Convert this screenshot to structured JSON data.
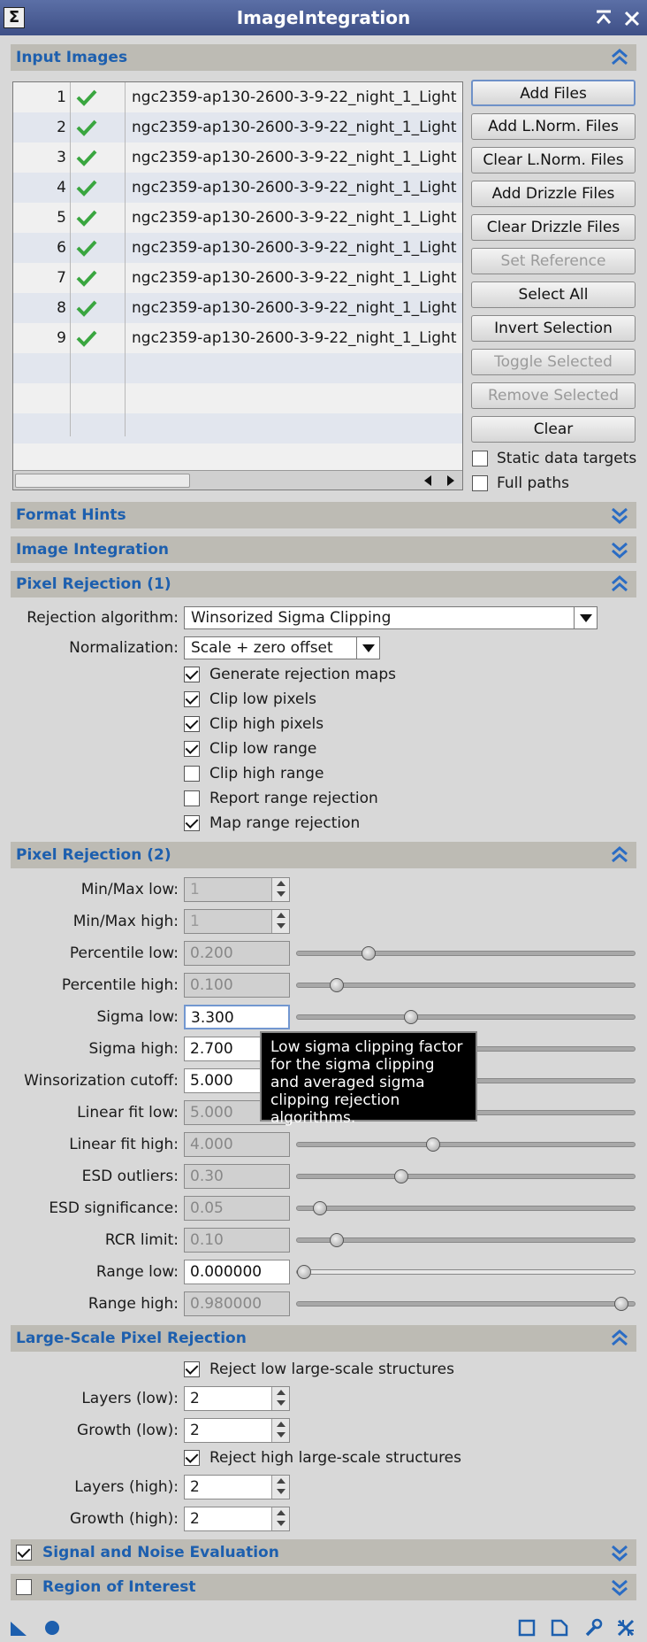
{
  "window": {
    "title": "ImageIntegration",
    "app_icon": "Σ",
    "collapse_icon": "collapse-icon",
    "close_icon": "close-icon"
  },
  "colors": {
    "section_title": "#1d5fae",
    "title_bar": "#4a5c94",
    "check_green": "#3aa640",
    "arrow_blue": "#2a6cc4"
  },
  "input_images": {
    "title": "Input Images",
    "files": [
      {
        "index": "1",
        "name": "ngc2359-ap130-2600-3-9-22_night_1_Light"
      },
      {
        "index": "2",
        "name": "ngc2359-ap130-2600-3-9-22_night_1_Light"
      },
      {
        "index": "3",
        "name": "ngc2359-ap130-2600-3-9-22_night_1_Light"
      },
      {
        "index": "4",
        "name": "ngc2359-ap130-2600-3-9-22_night_1_Light"
      },
      {
        "index": "5",
        "name": "ngc2359-ap130-2600-3-9-22_night_1_Light"
      },
      {
        "index": "6",
        "name": "ngc2359-ap130-2600-3-9-22_night_1_Light"
      },
      {
        "index": "7",
        "name": "ngc2359-ap130-2600-3-9-22_night_1_Light"
      },
      {
        "index": "8",
        "name": "ngc2359-ap130-2600-3-9-22_night_1_Light"
      },
      {
        "index": "9",
        "name": "ngc2359-ap130-2600-3-9-22_night_1_Light"
      }
    ],
    "buttons": {
      "add_files": "Add Files",
      "add_lnorm": "Add L.Norm. Files",
      "clear_lnorm": "Clear L.Norm. Files",
      "add_drizzle": "Add Drizzle Files",
      "clear_drizzle": "Clear Drizzle Files",
      "set_reference": "Set Reference",
      "select_all": "Select All",
      "invert_selection": "Invert Selection",
      "toggle_selected": "Toggle Selected",
      "remove_selected": "Remove Selected",
      "clear": "Clear"
    },
    "static_data_targets": "Static data targets",
    "full_paths": "Full paths"
  },
  "sections": {
    "format_hints": "Format Hints",
    "image_integration": "Image Integration",
    "pixel_rejection_1": "Pixel Rejection (1)",
    "pixel_rejection_2": "Pixel Rejection (2)",
    "large_scale": "Large-Scale Pixel Rejection",
    "signal_noise": "Signal and Noise Evaluation",
    "roi": "Region of Interest"
  },
  "pixel_rejection_1": {
    "rejection_algorithm_label": "Rejection algorithm:",
    "rejection_algorithm_value": "Winsorized Sigma Clipping",
    "normalization_label": "Normalization:",
    "normalization_value": "Scale + zero offset",
    "options": {
      "generate_maps": "Generate rejection maps",
      "clip_low_pixels": "Clip low pixels",
      "clip_high_pixels": "Clip high pixels",
      "clip_low_range": "Clip low range",
      "clip_high_range": "Clip high range",
      "report_range": "Report range rejection",
      "map_range": "Map range rejection"
    }
  },
  "pixel_rejection_2": {
    "minmax_low_label": "Min/Max low:",
    "minmax_low": "1",
    "minmax_high_label": "Min/Max high:",
    "minmax_high": "1",
    "percentile_low_label": "Percentile low:",
    "percentile_low": "0.200",
    "percentile_low_pos": 0.2,
    "percentile_high_label": "Percentile high:",
    "percentile_high": "0.100",
    "percentile_high_pos": 0.1,
    "sigma_low_label": "Sigma low:",
    "sigma_low": "3.300",
    "sigma_low_pos": 0.33,
    "sigma_high_label": "Sigma high:",
    "sigma_high": "2.700",
    "sigma_high_pos": 0.27,
    "winsor_label": "Winsorization cutoff:",
    "winsor": "5.000",
    "winsor_pos": 0.5,
    "linear_low_label": "Linear fit low:",
    "linear_low": "5.000",
    "linear_low_pos": 0.5,
    "linear_high_label": "Linear fit high:",
    "linear_high": "4.000",
    "linear_high_pos": 0.4,
    "esd_outliers_label": "ESD outliers:",
    "esd_outliers": "0.30",
    "esd_outliers_pos": 0.3,
    "esd_sig_label": "ESD significance:",
    "esd_sig": "0.05",
    "esd_sig_pos": 0.05,
    "rcr_label": "RCR limit:",
    "rcr": "0.10",
    "rcr_pos": 0.1,
    "range_low_label": "Range low:",
    "range_low": "0.000000",
    "range_low_pos": 0.0,
    "range_high_label": "Range high:",
    "range_high": "0.980000",
    "range_high_pos": 0.98
  },
  "tooltip": "Low sigma clipping factor for the sigma clipping and averaged sigma clipping rejection algorithms.",
  "large_scale": {
    "reject_low": "Reject low large-scale structures",
    "layers_low_label": "Layers (low):",
    "layers_low": "2",
    "growth_low_label": "Growth (low):",
    "growth_low": "2",
    "reject_high": "Reject high large-scale structures",
    "layers_high_label": "Layers (high):",
    "layers_high": "2",
    "growth_high_label": "Growth (high):",
    "growth_high": "2"
  }
}
